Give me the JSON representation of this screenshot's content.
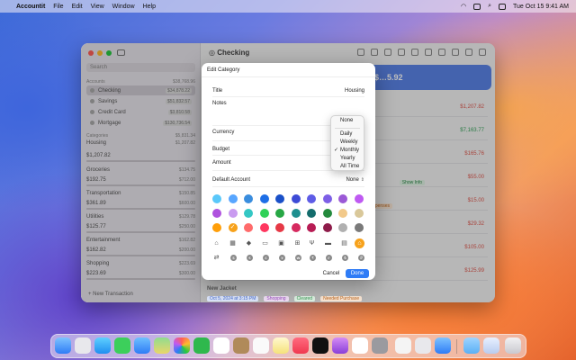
{
  "menubar": {
    "app_name": "Accountit",
    "menus": [
      "File",
      "Edit",
      "View",
      "Window",
      "Help"
    ],
    "clock": "Tue Oct 15  9:41 AM"
  },
  "window": {
    "title": "Checking",
    "search_placeholder": "Search",
    "accounts_label": "Accounts",
    "accounts_total": "$38,768.96",
    "accounts": [
      {
        "name": "Checking",
        "amount": "$34,878.22",
        "selected": true
      },
      {
        "name": "Savings",
        "amount": "$51,832.57"
      },
      {
        "name": "Credit Card",
        "amount": "$3,810.58"
      },
      {
        "name": "Mortgage",
        "amount": "$130,736.54"
      }
    ],
    "categories_label": "Categories",
    "categories_total": "$5,831.34",
    "categories": [
      {
        "name": "Housing",
        "amount": "$1,207.82"
      },
      {
        "name": "$1,207.82",
        "amount": ""
      },
      {
        "name": "Groceries",
        "amount": "$134.75"
      },
      {
        "name": "$192.75",
        "amount": "$712.00"
      },
      {
        "name": "Transportation",
        "amount": "$150.85"
      },
      {
        "name": "$361.89",
        "amount": "$600.00"
      },
      {
        "name": "Utilities",
        "amount": "$129.78"
      },
      {
        "name": "$125.77",
        "amount": "$250.00"
      },
      {
        "name": "Entertainment",
        "amount": "$162.82"
      },
      {
        "name": "$162.82",
        "amount": "$200.00"
      },
      {
        "name": "Shopping",
        "amount": "$223.69"
      },
      {
        "name": "$223.69",
        "amount": "$300.00"
      }
    ],
    "new_transaction": "New Transaction",
    "balance": "$…5.92",
    "transactions": [
      {
        "amount": "$1,207.82",
        "positive": false
      },
      {
        "amount": "$7,163.77",
        "positive": true
      },
      {
        "amount": "$165.76",
        "positive": false
      },
      {
        "amount": "$55.00",
        "positive": false,
        "tag": "Show Info"
      },
      {
        "amount": "$15.00",
        "positive": false,
        "tag": "Expenses"
      },
      {
        "amount": "$29.32",
        "positive": false
      },
      {
        "amount": "$105.00",
        "positive": false
      },
      {
        "amount": "$125.99",
        "positive": false
      }
    ],
    "last_tx_title": "New Jacket",
    "last_tx_tags": [
      "Oct 5, 2024 at 3:15 PM",
      "Shopping",
      "Cleared",
      "Needed Purchase"
    ]
  },
  "modal": {
    "title": "Edit Category",
    "title_label": "Title",
    "title_value": "Housing",
    "notes_label": "Notes",
    "currency_label": "Currency",
    "budget_label": "Budget",
    "amount_label": "Amount",
    "default_account_label": "Default Account",
    "default_account_value": "None",
    "cancel_label": "Cancel",
    "done_label": "Done"
  },
  "popup": {
    "options": [
      "None",
      "Daily",
      "Weekly",
      "Monthly",
      "Yearly",
      "All Time"
    ],
    "selected": "Monthly"
  },
  "colors": {
    "row1": [
      "#5ac8fa",
      "#58a6ff",
      "#3a8dde",
      "#1e6ee6",
      "#1a50c8",
      "#3d4bd6",
      "#5e5ce6",
      "#7d5fe6",
      "#9b59d6",
      "#bf5af2"
    ],
    "row2": [
      "#af52de",
      "#c99bf0",
      "#34c7c4",
      "#30d158",
      "#28a745",
      "#1e8f8f",
      "#146c6c",
      "#248a3d",
      "#f2c98a",
      "#d9c89a"
    ],
    "row3": [
      "#ff9f0a",
      "#f7a21b",
      "#ff6b6b",
      "#ff375f",
      "#e63946",
      "#d62a5f",
      "#b71c54",
      "#8e1c4a",
      "#b0b0b0",
      "#7a7a7a"
    ]
  }
}
